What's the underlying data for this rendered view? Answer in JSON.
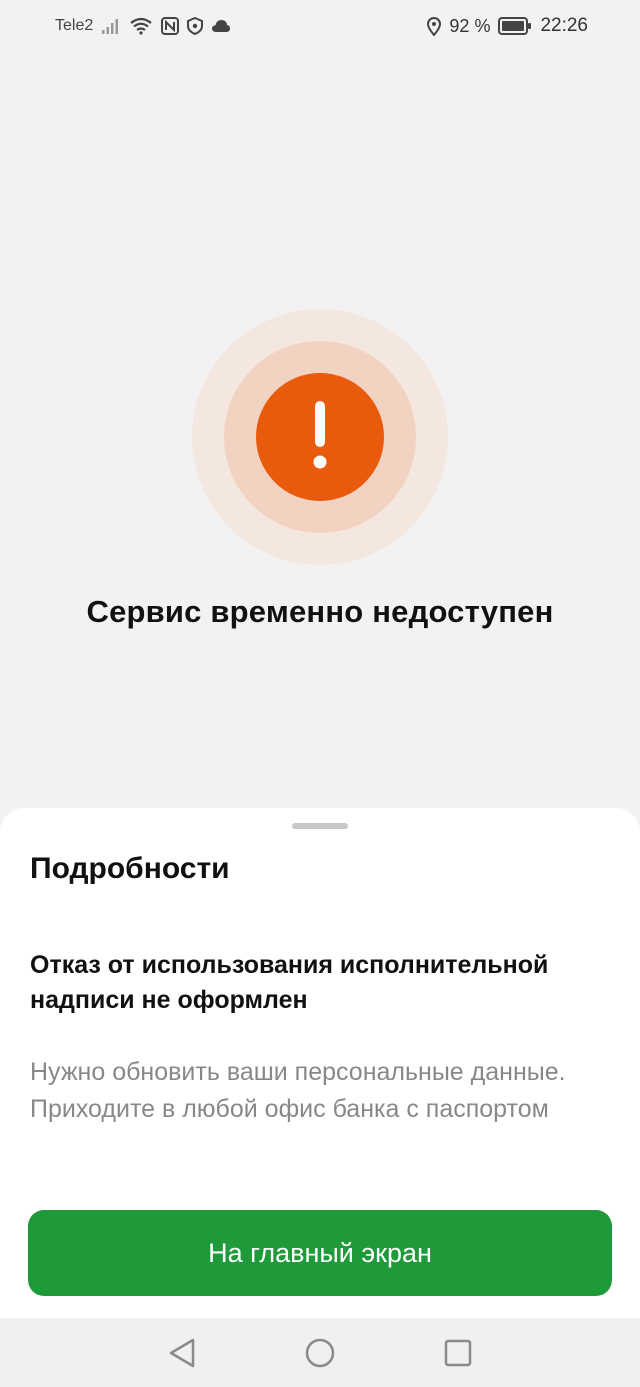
{
  "status_bar": {
    "carrier": "Tele2",
    "battery_percent": "92 %",
    "time": "22:26",
    "icons": [
      "signal-icon",
      "wifi-icon",
      "nfc-icon",
      "shield-icon",
      "cloud-icon",
      "location-icon",
      "battery-icon"
    ]
  },
  "error": {
    "icon": "exclamation-icon",
    "accent_color": "#e85a0c",
    "title": "Сервис временно недоступен"
  },
  "details_sheet": {
    "title": "Подробности",
    "subtitle": "Отказ от использования исполнительной надписи не оформлен",
    "body": "Нужно обновить ваши персональные данные. Приходите в любой офис банка с паспортом",
    "button_label": "На главный экран",
    "button_color": "#1f9a3a"
  },
  "navigation": {
    "icons": [
      "back-icon",
      "home-icon",
      "recents-icon"
    ]
  }
}
